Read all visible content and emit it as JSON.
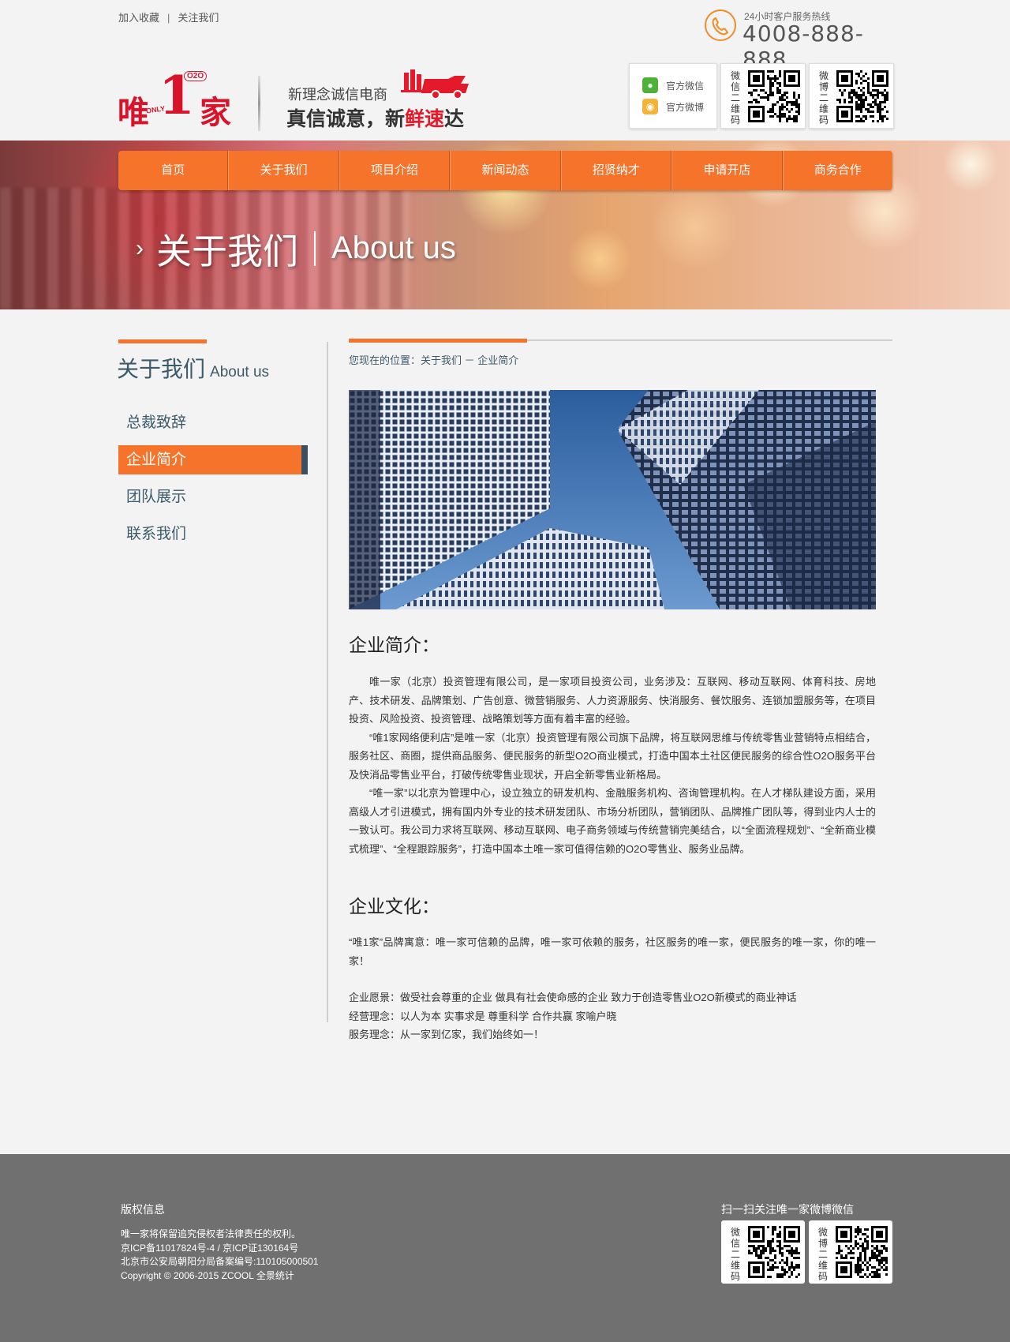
{
  "top": {
    "links": [
      "加入收藏",
      "关注我们"
    ],
    "sep": "|",
    "hotline_label": "24小时客户服务热线",
    "hotline_number": "4008-888-888"
  },
  "logo": {
    "char1": "唯",
    "char2": "1",
    "char3": "家",
    "o2o": "O2O",
    "only": "ONLY"
  },
  "slogan": {
    "line1": "新理念诚信电商",
    "line2a": "真信诚意，新",
    "line2b": "鲜速",
    "line2c": "达"
  },
  "social": {
    "wechat": "官方微信",
    "weibo": "官方微博",
    "wechat_qr_label": "微信二维码",
    "weibo_qr_label": "微博二维码"
  },
  "nav": [
    "首页",
    "关于我们",
    "项目介绍",
    "新闻动态",
    "招贤纳才",
    "申请开店",
    "商务合作"
  ],
  "banner": {
    "chevron": "›",
    "title_cn": "关于我们",
    "title_en": "About us"
  },
  "sidebar": {
    "title_cn": "关于我们",
    "title_en": "About us",
    "items": [
      "总裁致辞",
      "企业简介",
      "团队展示",
      "联系我们"
    ],
    "active": 1
  },
  "breadcrumb": "您现在的位置：关于我们 － 企业简介",
  "content": {
    "intro_heading": "企业简介：",
    "intro_paragraphs": [
      "唯一家（北京）投资管理有限公司，是一家项目投资公司，业务涉及：互联网、移动互联网、体育科技、房地产、技术研发、品牌策划、广告创意、微营销服务、人力资源服务、快消服务、餐饮服务、连锁加盟服务等，在项目投资、风险投资、投资管理、战略策划等方面有着丰富的经验。",
      "“唯1家网络便利店”是唯一家（北京）投资管理有限公司旗下品牌，将互联网思维与传统零售业营销特点相结合，服务社区、商圈，提供商品服务、便民服务的新型O2O商业模式，打造中国本土社区便民服务的综合性O2O服务平台及快消品零售业平台，打破传统零售业现状，开启全新零售业新格局。",
      "“唯一家”以北京为管理中心，设立独立的研发机构、金融服务机构、咨询管理机构。在人才梯队建设方面，采用高级人才引进模式，拥有国内外专业的技术研发团队、市场分析团队，营销团队、品牌推广团队等，得到业内人士的一致认可。我公司力求将互联网、移动互联网、电子商务领域与传统营销完美结合，以“全面流程规划”、“全新商业模式梳理”、“全程跟踪服务”，打造中国本土唯一家可值得信赖的O2O零售业、服务业品牌。"
    ],
    "culture_heading": "企业文化：",
    "culture_paragraph": "“唯1家”品牌寓意：唯一家可信赖的品牌，唯一家可依赖的服务，社区服务的唯一家，便民服务的唯一家，你的唯一家！",
    "culture_lines": [
      "企业愿景：做受社会尊重的企业  做具有社会使命感的企业  致力于创造零售业O2O新模式的商业神话",
      "经营理念：以人为本  实事求是   尊重科学  合作共赢   家喻户晓",
      "服务理念：从一家到亿家，我们始终如一！"
    ]
  },
  "footer": {
    "title": "版权信息",
    "lines": [
      "唯一家将保留追究侵权者法律责任的权利。",
      "京ICP备11017824号-4 / 京ICP证130164号",
      "北京市公安局朝阳分局备案编号:110105000501",
      "Copyright © 2006-2015 ZCOOL 全景统计"
    ],
    "qr_title": "扫一扫关注唯一家微博微信",
    "wechat_qr_label": "微信二维码",
    "weibo_qr_label": "微博二维码"
  },
  "colors": {
    "accent": "#f6732b",
    "brand_red": "#d9132a",
    "sidebar_text": "#3d5a6a",
    "footer_bg": "#707070"
  },
  "icons": [
    "phone-icon",
    "wechat-icon",
    "weibo-icon",
    "qr-code-icon",
    "delivery-truck-icon",
    "chevron-right-icon"
  ]
}
